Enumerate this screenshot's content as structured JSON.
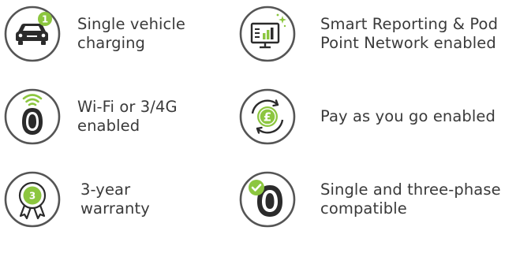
{
  "colors": {
    "green": "#8cc63f",
    "dark": "#2b2b2b",
    "ring": "#555555",
    "text": "#3a3a3a"
  },
  "features": [
    {
      "icon": "car-charging-icon",
      "lines": [
        "Single vehicle",
        "charging"
      ],
      "badge": "1"
    },
    {
      "icon": "chart-monitor-icon",
      "lines": [
        "Smart Reporting & Pod",
        "Point Network enabled"
      ]
    },
    {
      "icon": "wifi-charger-icon",
      "lines": [
        "Wi-Fi or 3/4G",
        "enabled"
      ]
    },
    {
      "icon": "pound-coin-icon",
      "lines": [
        "Pay as you go enabled"
      ],
      "badge": "£"
    },
    {
      "icon": "warranty-rosette-icon",
      "lines": [
        "3-year",
        "warranty"
      ],
      "badge": "3"
    },
    {
      "icon": "check-charger-icon",
      "lines": [
        "Single and three-phase",
        "compatible"
      ]
    }
  ]
}
